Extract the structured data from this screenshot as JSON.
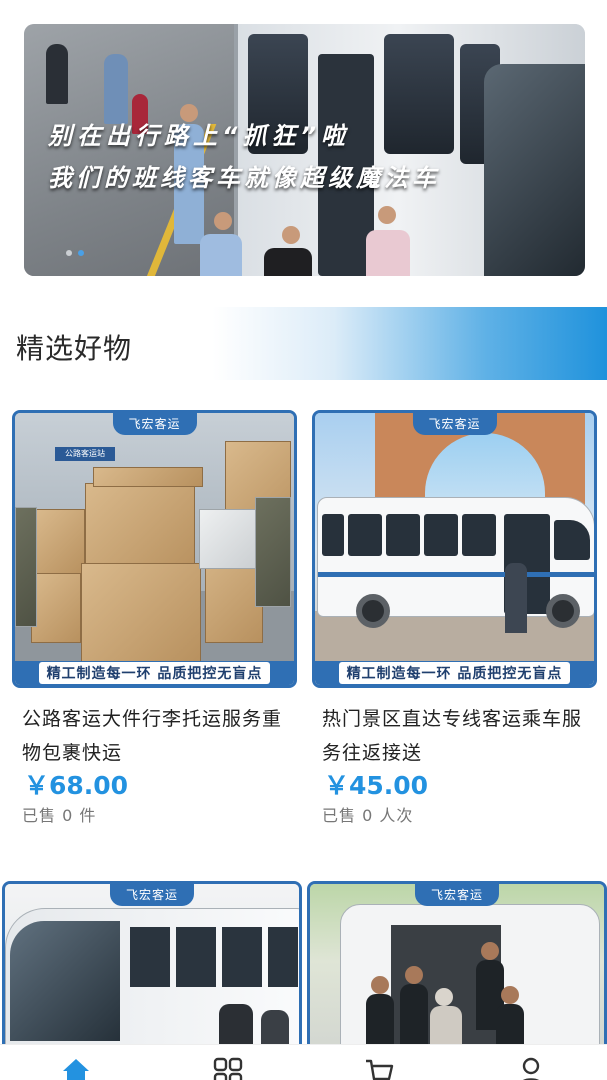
{
  "banner": {
    "slogan_line1": "别在出行路上“抓狂”啦",
    "slogan_line2": "我们的班线客车就像超级魔法车",
    "dots": [
      false,
      true
    ]
  },
  "section": {
    "title": "精选好物"
  },
  "products": [
    {
      "brand_tag": "飞宏客运",
      "banner_text": "精工制造每一环 品质把控无盲点",
      "name": "公路客运大件行李托运服务重物包裹快运",
      "price": "￥68.00",
      "sold": "已售 0 件",
      "image": "parcels-at-bus-station",
      "sign_text": "公路客运站"
    },
    {
      "brand_tag": "飞宏客运",
      "banner_text": "精工制造每一环 品质把控无盲点",
      "name": "热门景区直达专线客运乘车服务往返接送",
      "price": "￥45.00",
      "sold": "已售 0 人次",
      "image": "white-bus-at-scenic-arch"
    },
    {
      "brand_tag": "飞宏客运",
      "image": "coach-bus-boarding"
    },
    {
      "brand_tag": "飞宏客运",
      "image": "police-assisting-elderly-at-van"
    }
  ],
  "tabbar": {
    "items": [
      {
        "icon": "home-icon",
        "active": true
      },
      {
        "icon": "category-icon",
        "active": false
      },
      {
        "icon": "cart-icon",
        "active": false
      },
      {
        "icon": "user-icon",
        "active": false
      }
    ]
  },
  "colors": {
    "accent": "#2392e0",
    "card_border": "#2f6fb4",
    "tab_active": "#2392e0",
    "tab_inactive": "#333333"
  }
}
